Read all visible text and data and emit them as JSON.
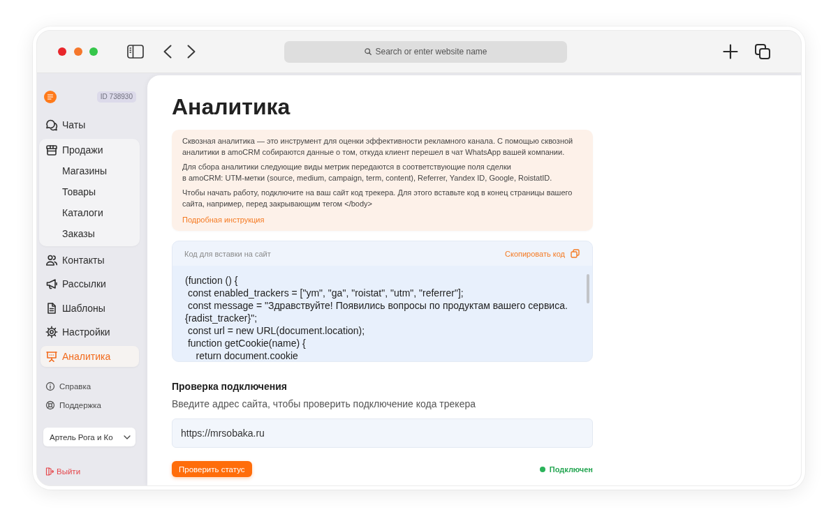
{
  "browser": {
    "address_bar": {
      "placeholder": "Search or enter website name"
    }
  },
  "sidebar": {
    "account_id": "ID 738930",
    "nav": [
      {
        "label": "Чаты",
        "selected": false
      },
      {
        "label": "Продажи",
        "selected": false,
        "expanded": true,
        "children": [
          {
            "label": "Магазины",
            "selected": false
          },
          {
            "label": "Товары",
            "selected": false
          },
          {
            "label": "Каталоги",
            "selected": false
          },
          {
            "label": "Заказы",
            "selected": false
          }
        ]
      },
      {
        "label": "Контакты",
        "selected": false
      },
      {
        "label": "Рассылки",
        "selected": false
      },
      {
        "label": "Шаблоны",
        "selected": false
      },
      {
        "label": "Настройки",
        "selected": false
      },
      {
        "label": "Аналитика",
        "selected": true
      }
    ],
    "links": [
      {
        "label": "Справка"
      },
      {
        "label": "Поддержка"
      }
    ],
    "account_select": {
      "value": "Артель Рога и Ко"
    },
    "logout": "Выйти"
  },
  "page": {
    "title": "Аналитика",
    "info": {
      "paragraphs": [
        [
          "Сквозная аналитика — это инструмент для оценки эффективности рекламного канала. С помощью сквозной",
          "аналитики в amoCRM собираются данные о том, откуда клиент перешел в чат WhatsApp вашей компании."
        ],
        [
          "Для сбора аналитики следующие виды метрик передаются в соответствующие поля сделки",
          "в amoCRM: UTM-метки (source, medium, campaign, term, content), Referrer, Yandex ID, Google, RoistatID."
        ],
        [
          "Чтобы начать работу, подключите на ваш сайт код трекера. Для этого вставьте код в конец страницы вашего",
          "сайта, например, перед закрывающим тегом </body>"
        ]
      ],
      "link": "Подробная инструкция"
    },
    "code": {
      "title": "Код для вставки на сайт",
      "copy_button": "Скопировать код",
      "lines": [
        "(function () {",
        " const enabled_trackers = [\"ym\", \"ga\", \"roistat\", \"utm\", \"referrer\"];",
        " const message = \"Здравствуйте! Появились вопросы по продуктам вашего сервиса.",
        "{radist_tracker}\";",
        " const url = new URL(document.location);",
        " function getCookie(name) {",
        "    return document.cookie"
      ]
    },
    "check": {
      "title": "Проверка подключения",
      "description": "Введите адрес сайта, чтобы проверить подключение кода трекера",
      "url_field": {
        "value": "https://mrsobaka.ru"
      },
      "button": "Проверить статус",
      "status": {
        "label": "Подключен",
        "connected": true
      }
    }
  }
}
